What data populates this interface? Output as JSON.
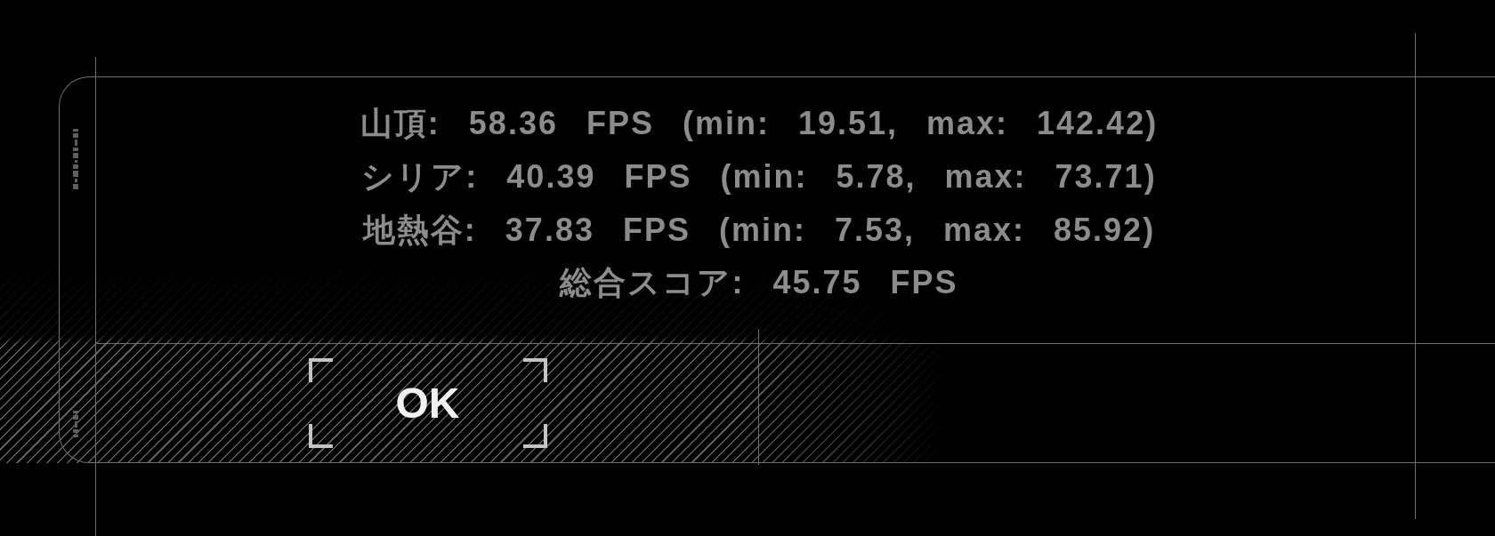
{
  "result_lines": [
    "山頂: 58.36 FPS (min: 19.51, max: 142.42)",
    "シリア: 40.39 FPS (min: 5.78, max: 73.71)",
    "地熱谷: 37.83 FPS (min: 7.53, max: 85.92)"
  ],
  "total_score": "総合スコア: 45.75 FPS",
  "ok_button": {
    "label": "OK"
  }
}
